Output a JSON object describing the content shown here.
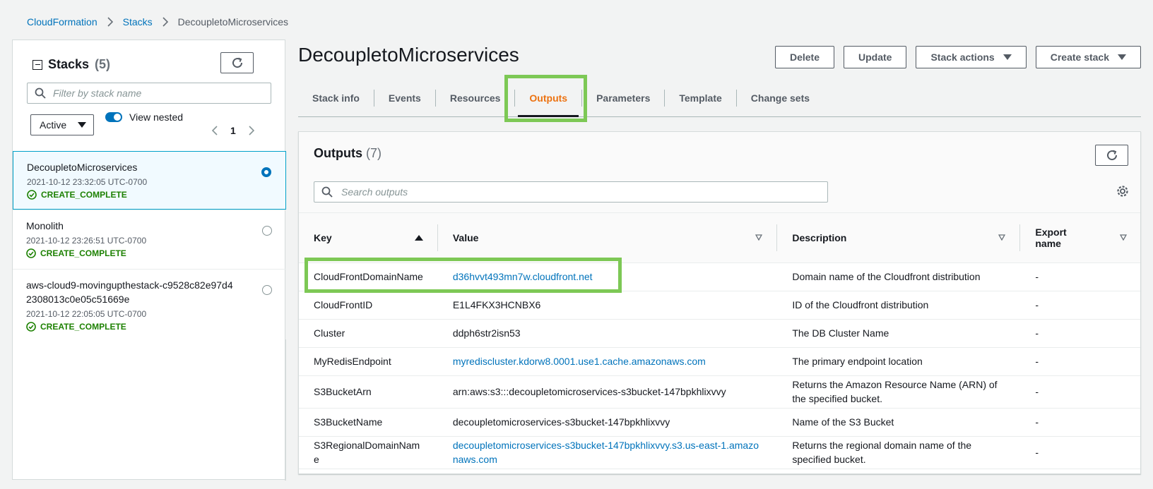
{
  "breadcrumb": {
    "items": [
      "CloudFormation",
      "Stacks"
    ],
    "current": "DecoupletoMicroservices"
  },
  "left_panel": {
    "title": "Stacks",
    "count": "(5)",
    "filter_placeholder": "Filter by stack name",
    "status_filter": "Active",
    "view_nested_label": "View nested",
    "page": "1",
    "stacks": [
      {
        "name": "DecoupletoMicroservices",
        "time": "2021-10-12 23:32:05 UTC-0700",
        "status": "CREATE_COMPLETE",
        "selected": true
      },
      {
        "name": "Monolith",
        "time": "2021-10-12 23:26:51 UTC-0700",
        "status": "CREATE_COMPLETE",
        "selected": false
      },
      {
        "name": "aws-cloud9-movingupthestack-c9528c82e97d42308013c0e05c51669e",
        "time": "2021-10-12 22:05:05 UTC-0700",
        "status": "CREATE_COMPLETE",
        "selected": false
      }
    ]
  },
  "main": {
    "title": "DecoupletoMicroservices",
    "actions": {
      "delete": "Delete",
      "update": "Update",
      "stack_actions": "Stack actions",
      "create_stack": "Create stack"
    },
    "tabs": [
      "Stack info",
      "Events",
      "Resources",
      "Outputs",
      "Parameters",
      "Template",
      "Change sets"
    ],
    "active_tab": "Outputs"
  },
  "outputs": {
    "title": "Outputs",
    "count": "(7)",
    "search_placeholder": "Search outputs",
    "columns": {
      "key": "Key",
      "value": "Value",
      "description": "Description",
      "export_line1": "Export",
      "export_line2": "name"
    },
    "rows": [
      {
        "key": "CloudFrontDomainName",
        "value": "d36hvvt493mn7w.cloudfront.net",
        "value_is_link": true,
        "description": "Domain name of the Cloudfront distribution",
        "export": "-"
      },
      {
        "key": "CloudFrontID",
        "value": "E1L4FKX3HCNBX6",
        "value_is_link": false,
        "description": "ID of the Cloudfront distribution",
        "export": "-"
      },
      {
        "key": "Cluster",
        "value": "ddph6str2isn53",
        "value_is_link": false,
        "description": "The DB Cluster Name",
        "export": "-"
      },
      {
        "key": "MyRedisEndpoint",
        "value": "myrediscluster.kdorw8.0001.use1.cache.amazonaws.com",
        "value_is_link": true,
        "description": "The primary endpoint location",
        "export": "-"
      },
      {
        "key": "S3BucketArn",
        "value": "arn:aws:s3:::decoupletomicroservices-s3bucket-147bpkhlixvvy",
        "value_is_link": false,
        "description": "Returns the Amazon Resource Name (ARN) of the specified bucket.",
        "export": "-"
      },
      {
        "key": "S3BucketName",
        "value": "decoupletomicroservices-s3bucket-147bpkhlixvvy",
        "value_is_link": false,
        "description": "Name of the S3 Bucket",
        "export": "-"
      },
      {
        "key": "S3RegionalDomainName",
        "value": "decoupletomicroservices-s3bucket-147bpkhlixvvy.s3.us-east-1.amazonaws.com",
        "value_is_link": true,
        "description": "Returns the regional domain name of the specified bucket.",
        "export": "-"
      }
    ]
  },
  "colors": {
    "link": "#0073bb",
    "success": "#1d8102",
    "active_tab": "#ec7211",
    "highlight": "#7dc855"
  }
}
